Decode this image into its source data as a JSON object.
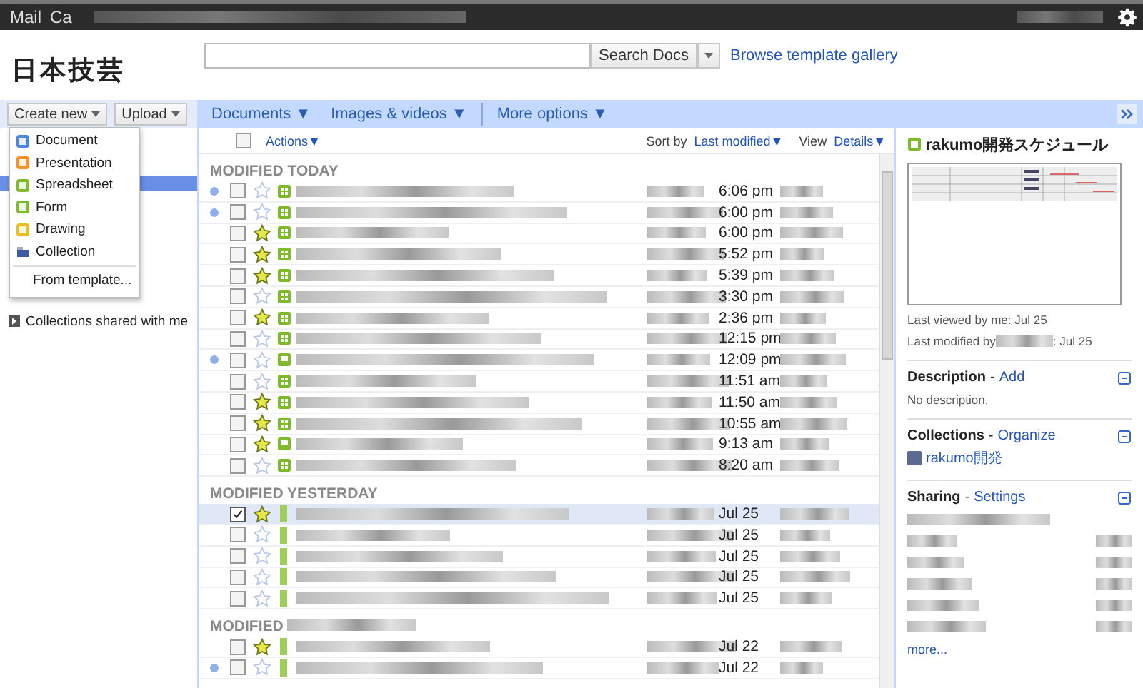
{
  "top_bar": {
    "links": [
      "Mail",
      "Ca"
    ]
  },
  "logo": "日本技芸",
  "search": {
    "button": "Search Docs",
    "link": "Browse template gallery"
  },
  "buttons": [
    "Create new",
    "Upload"
  ],
  "create_menu": [
    {
      "label": "Document",
      "kind": "document"
    },
    {
      "label": "Presentation",
      "kind": "presentation"
    },
    {
      "label": "Spreadsheet",
      "kind": "spreadsheet"
    },
    {
      "label": "Form",
      "kind": "form"
    },
    {
      "label": "Drawing",
      "kind": "drawing"
    },
    {
      "label": "Collection",
      "kind": "collection"
    },
    {
      "label": "From template...",
      "kind": "template"
    }
  ],
  "sidebar": {
    "items": [
      {
        "label": "Collections shared with me",
        "selected": false
      }
    ]
  },
  "toolbar": [
    "Documents ▼",
    "Images & videos ▼",
    "More options ▼"
  ],
  "list": {
    "select_all_checked": false,
    "actions": "Actions▼",
    "sort_label": "Sort by",
    "sort_value": "Last modified▼",
    "view_label": "View",
    "view_value": "Details▼"
  },
  "groups": [
    {
      "title": "MODIFIED TODAY",
      "rows": [
        {
          "unread": true,
          "checked": false,
          "starred": false,
          "kind": "spreadsheet",
          "date": "6:06 pm"
        },
        {
          "unread": true,
          "checked": false,
          "starred": false,
          "kind": "spreadsheet",
          "date": "6:00 pm"
        },
        {
          "unread": false,
          "checked": false,
          "starred": true,
          "kind": "spreadsheet",
          "date": "6:00 pm"
        },
        {
          "unread": false,
          "checked": false,
          "starred": true,
          "kind": "spreadsheet",
          "date": "5:52 pm"
        },
        {
          "unread": false,
          "checked": false,
          "starred": true,
          "kind": "spreadsheet",
          "date": "5:39 pm"
        },
        {
          "unread": false,
          "checked": false,
          "starred": false,
          "kind": "spreadsheet",
          "date": "3:30 pm"
        },
        {
          "unread": false,
          "checked": false,
          "starred": true,
          "kind": "spreadsheet",
          "date": "2:36 pm"
        },
        {
          "unread": false,
          "checked": false,
          "starred": false,
          "kind": "spreadsheet",
          "date": "12:15 pm"
        },
        {
          "unread": true,
          "checked": false,
          "starred": false,
          "kind": "form",
          "date": "12:09 pm"
        },
        {
          "unread": false,
          "checked": false,
          "starred": false,
          "kind": "spreadsheet",
          "date": "11:51 am"
        },
        {
          "unread": false,
          "checked": false,
          "starred": true,
          "kind": "spreadsheet",
          "date": "11:50 am"
        },
        {
          "unread": false,
          "checked": false,
          "starred": true,
          "kind": "spreadsheet",
          "date": "10:55 am"
        },
        {
          "unread": false,
          "checked": false,
          "starred": true,
          "kind": "form",
          "date": "9:13 am"
        },
        {
          "unread": false,
          "checked": false,
          "starred": false,
          "kind": "spreadsheet",
          "date": "8:20 am"
        }
      ]
    },
    {
      "title": "MODIFIED YESTERDAY",
      "rows": [
        {
          "unread": false,
          "checked": true,
          "starred": true,
          "kind": "spreadsheet",
          "date": "Jul 25"
        },
        {
          "unread": false,
          "checked": false,
          "starred": false,
          "kind": "spreadsheet",
          "date": "Jul 25"
        },
        {
          "unread": false,
          "checked": false,
          "starred": false,
          "kind": "spreadsheet",
          "date": "Jul 25"
        },
        {
          "unread": false,
          "checked": false,
          "starred": false,
          "kind": "spreadsheet",
          "date": "Jul 25"
        },
        {
          "unread": false,
          "checked": false,
          "starred": false,
          "kind": "spreadsheet",
          "date": "Jul 25"
        }
      ]
    },
    {
      "title": "MODIFIED",
      "rows": [
        {
          "unread": false,
          "checked": false,
          "starred": true,
          "kind": "spreadsheet",
          "date": "Jul 22"
        },
        {
          "unread": true,
          "checked": false,
          "starred": false,
          "kind": "spreadsheet",
          "date": "Jul 22"
        }
      ]
    }
  ],
  "details": {
    "title": "rakumo開発スケジュール",
    "last_viewed": "Last viewed by me: Jul 25",
    "last_modified_prefix": "Last modified by",
    "last_modified_suffix": ": Jul 25",
    "sections": [
      {
        "kind": "description",
        "title": "Description",
        "separator": "-",
        "action": "Add",
        "body": "No description."
      },
      {
        "kind": "collections",
        "title": "Collections",
        "separator": "-",
        "action": "Organize",
        "collection": "rakumo開発"
      },
      {
        "kind": "sharing",
        "title": "Sharing",
        "separator": "-",
        "action": "Settings",
        "more": "more..."
      }
    ]
  }
}
